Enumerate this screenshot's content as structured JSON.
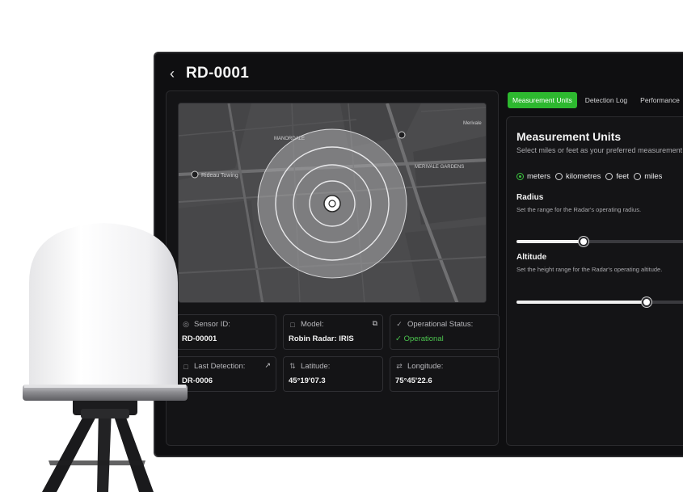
{
  "header": {
    "back_icon": "chevron-left-icon",
    "title": "RD-0001"
  },
  "map": {
    "labels": [
      "MANORDALE",
      "MERIVALE GARDENS",
      "Rideau Towing",
      "Merivale"
    ]
  },
  "cards": [
    {
      "label": "Sensor ID:",
      "value": "RD-00001",
      "icon": "sensor-icon"
    },
    {
      "label": "Model:",
      "value": "Robin Radar: IRIS",
      "icon": "document-icon",
      "action_icon": "copy-icon"
    },
    {
      "label": "Operational Status:",
      "value": "Operational",
      "icon": "check-circle-icon",
      "status_color": "#4cc44f"
    },
    {
      "label": "Last Detection:",
      "value": "DR-0006",
      "icon": "document-icon",
      "action_icon": "external-link-icon"
    },
    {
      "label": "Latitude:",
      "value": "45°19'07.3",
      "icon": "latitude-icon"
    },
    {
      "label": "Longitude:",
      "value": "75°45'22.6",
      "icon": "longitude-icon"
    }
  ],
  "tabs": [
    {
      "label": "Measurement Units",
      "active": true
    },
    {
      "label": "Detection Log",
      "active": false
    },
    {
      "label": "Performance",
      "active": false
    }
  ],
  "measurement": {
    "title": "Measurement Units",
    "subtitle": "Select miles or feet as your preferred measurement",
    "units": [
      {
        "label": "meters",
        "selected": true
      },
      {
        "label": "kilometres",
        "selected": false
      },
      {
        "label": "feet",
        "selected": false
      },
      {
        "label": "miles",
        "selected": false
      }
    ],
    "radius": {
      "title": "Radius",
      "subtitle": "Set the range for the Radar's operating radius.",
      "value_fraction": 0.32
    },
    "altitude": {
      "title": "Altitude",
      "subtitle": "Set the height range for the Radar's operating altitude.",
      "value_fraction": 0.62
    }
  },
  "colors": {
    "accent": "#2db82f",
    "background": "#0f0f11",
    "panel": "#141416"
  }
}
